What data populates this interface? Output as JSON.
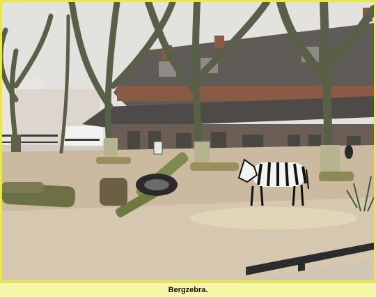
{
  "caption": "Bergzebra.",
  "colors": {
    "frame": "#e8e84a",
    "caption_bg": "#f6f7a8",
    "sky": "#e4e2df",
    "ground": "#cbb9a0",
    "roof": "#5f5b57",
    "building_wall": "#6b5f55"
  },
  "scene": {
    "subject": "zebra-icon",
    "elements": [
      "tree-icon",
      "building-icon",
      "tire-icon",
      "log-icon",
      "fence-rail-icon"
    ]
  }
}
